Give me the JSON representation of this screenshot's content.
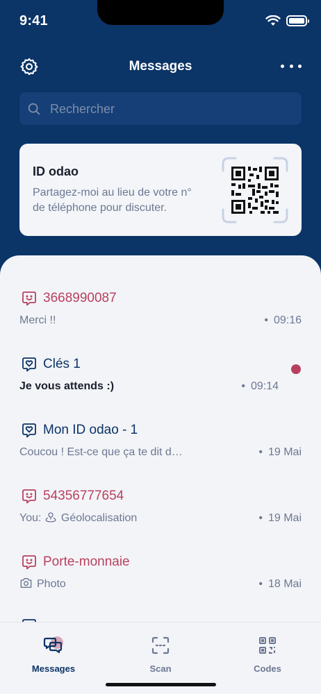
{
  "status_bar": {
    "time": "9:41"
  },
  "header": {
    "title": "Messages"
  },
  "search": {
    "placeholder": "Rechercher"
  },
  "id_card": {
    "title": "ID odao",
    "description": "Partagez-moi au lieu de votre n° de téléphone pour discuter."
  },
  "conversations": [
    {
      "name": "3668990087",
      "preview": "Merci !!",
      "time": "09:16",
      "icon": "smiley-chat-icon",
      "unread": false
    },
    {
      "name": "Clés 1",
      "preview": "Je vous attends :)",
      "time": "09:14",
      "icon": "heart-chat-icon",
      "unread": true
    },
    {
      "name": "Mon ID odao - 1",
      "preview": "Coucou ! Est-ce que ça te dit d…",
      "time": "19 Mai",
      "icon": "heart-chat-icon",
      "unread": false
    },
    {
      "name": "54356777654",
      "preview_prefix": "You:",
      "preview": "Géolocalisation",
      "time": "19 Mai",
      "icon": "smiley-chat-icon",
      "preview_icon": "location-person-icon",
      "unread": false
    },
    {
      "name": "Porte-monnaie",
      "preview": "Photo",
      "time": "18 Mai",
      "icon": "smiley-chat-icon",
      "preview_icon": "camera-icon",
      "unread": false
    }
  ],
  "separator": "•",
  "tabs": [
    {
      "label": "Messages",
      "icon": "chat-bubbles-icon",
      "active": true
    },
    {
      "label": "Scan",
      "icon": "scan-frame-icon",
      "active": false
    },
    {
      "label": "Codes",
      "icon": "qr-code-icon",
      "active": false
    }
  ],
  "colors": {
    "brand_navy": "#0b3467",
    "accent_red": "#b8405e",
    "sheet_bg": "#f3f4f8"
  }
}
